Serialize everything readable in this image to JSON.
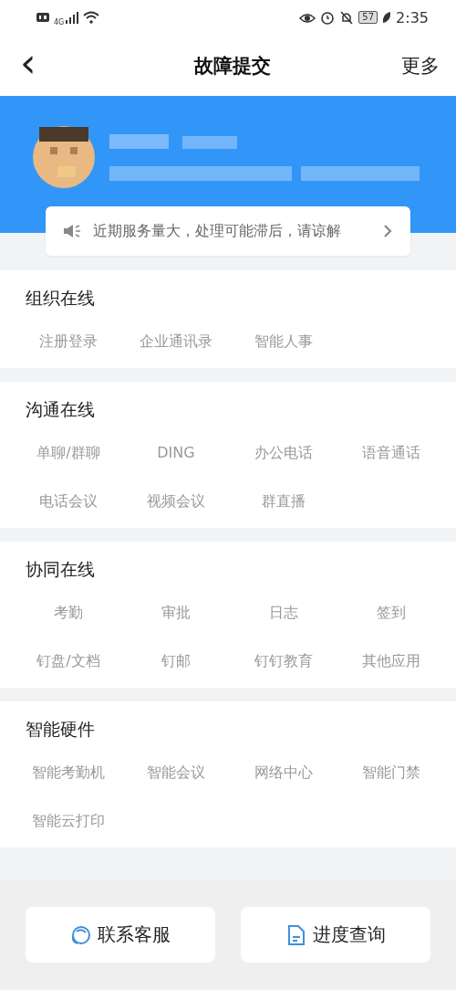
{
  "status_bar": {
    "network": "4G",
    "battery": "57",
    "time": "2:35"
  },
  "nav": {
    "back": "‹",
    "title": "故障提交",
    "more": "更多"
  },
  "notice": {
    "text": "近期服务量大，处理可能滞后，请谅解"
  },
  "sections": [
    {
      "title": "组织在线",
      "items": [
        "注册登录",
        "企业通讯录",
        "智能人事"
      ]
    },
    {
      "title": "沟通在线",
      "items": [
        "单聊/群聊",
        "DING",
        "办公电话",
        "语音通话",
        "电话会议",
        "视频会议",
        "群直播"
      ]
    },
    {
      "title": "协同在线",
      "items": [
        "考勤",
        "审批",
        "日志",
        "签到",
        "钉盘/文档",
        "钉邮",
        "钉钉教育",
        "其他应用"
      ]
    },
    {
      "title": "智能硬件",
      "items": [
        "智能考勤机",
        "智能会议",
        "网络中心",
        "智能门禁",
        "智能云打印"
      ]
    }
  ],
  "bottom_buttons": [
    {
      "kind": "support",
      "label": "联系客服"
    },
    {
      "kind": "document",
      "label": "进度查询"
    }
  ]
}
